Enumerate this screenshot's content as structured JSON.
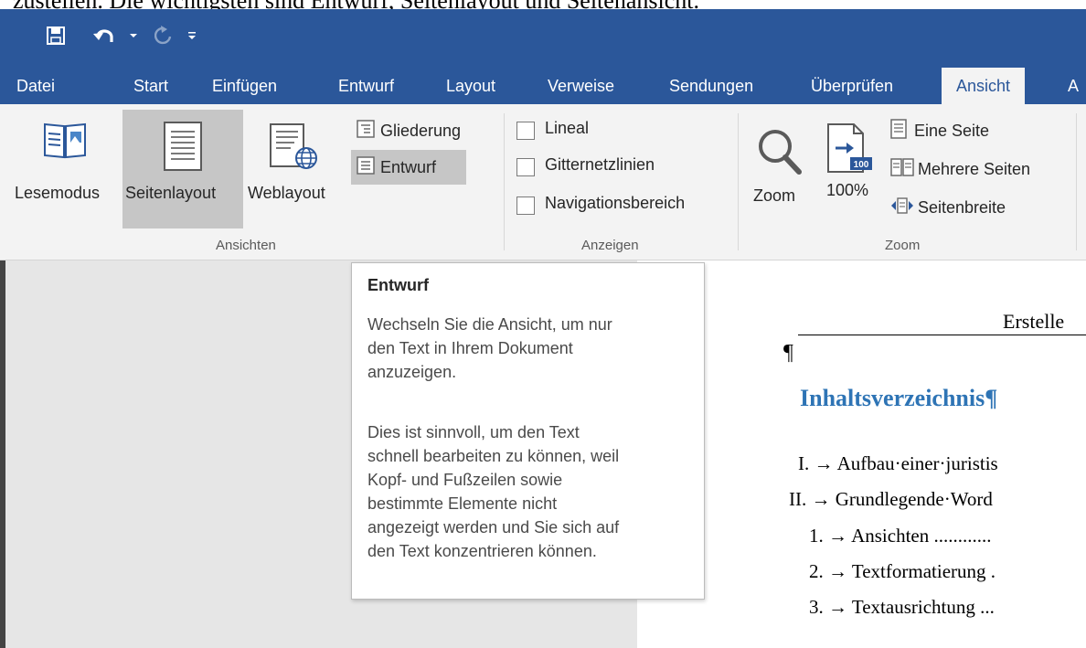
{
  "top_text": "zustellen. Die wichtigsten sind Entwurf, Seitenlayout und Seitenansicht.",
  "qat": {
    "save_icon": "save-icon",
    "undo_icon": "undo-icon",
    "redo_icon": "redo-icon",
    "customize_icon": "customize-qat-icon"
  },
  "tabs": [
    "Datei",
    "Start",
    "Einfügen",
    "Entwurf",
    "Layout",
    "Verweise",
    "Sendungen",
    "Überprüfen",
    "Ansicht",
    "A"
  ],
  "active_tab": "Ansicht",
  "ribbon": {
    "ansichten": {
      "lesemodus": "Lesemodus",
      "seitenlayout": "Seitenlayout",
      "weblayout": "Weblayout",
      "gliederung": "Gliederung",
      "entwurf": "Entwurf",
      "group_label": "Ansichten"
    },
    "anzeigen": {
      "lineal": "Lineal",
      "gitternetzlinien": "Gitternetzlinien",
      "navigationsbereich": "Navigationsbereich",
      "group_label": "Anzeigen"
    },
    "zoom": {
      "zoom": "Zoom",
      "percent": "100%",
      "percent_badge": "100",
      "eine_seite": "Eine Seite",
      "mehrere_seiten": "Mehrere Seiten",
      "seitenbreite": "Seitenbreite",
      "group_label": "Zoom"
    }
  },
  "tooltip": {
    "title": "Entwurf",
    "para1": [
      "Wechseln Sie die Ansicht, um nur",
      "den Text in Ihrem Dokument",
      "anzuzeigen."
    ],
    "para2": [
      "Dies ist sinnvoll, um den Text",
      "schnell bearbeiten zu können, weil",
      "Kopf- und Fußzeilen sowie",
      "bestimmte Elemente nicht",
      "angezeigt werden und Sie sich auf",
      "den Text konzentrieren können."
    ]
  },
  "document": {
    "header_text": "Erstelle",
    "pilcrow": "¶",
    "heading": "Inhaltsverzeichnis¶",
    "toc": [
      {
        "num": "I.",
        "text": "Aufbau·einer·juristis"
      },
      {
        "num": "II.",
        "text": "Grundlegende·Word"
      },
      {
        "num": "1.",
        "text": "Ansichten ............"
      },
      {
        "num": "2.",
        "text": "Textformatierung ."
      },
      {
        "num": "3.",
        "text": "Textausrichtung ..."
      }
    ]
  },
  "colors": {
    "brand": "#2b579a",
    "heading": "#2e74b5"
  }
}
